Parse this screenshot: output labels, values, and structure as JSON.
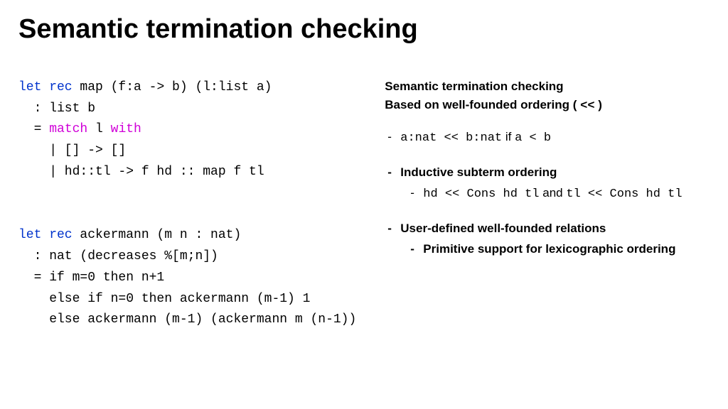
{
  "title": "Semantic termination checking",
  "code": {
    "map": {
      "l1a": "let rec",
      "l1b": " map (f:a -> b) (l:list a)",
      "l2": "  : list b",
      "l3a": "  = ",
      "l3b": "match",
      "l3c": " l ",
      "l3d": "with",
      "l4": "    | [] -> []",
      "l5": "    | hd::tl -> f hd :: map f tl"
    },
    "ack": {
      "l1a": "let rec",
      "l1b": " ackermann (m n : nat)",
      "l2": "  : nat (decreases %[m;n])",
      "l3": "  = if m=0 then n+1",
      "l4": "    else if n=0 then ackermann (m-1) 1",
      "l5": "    else ackermann (m-1) (ackermann m (n-1))"
    }
  },
  "notes": {
    "h1": "Semantic termination checking",
    "h2a": "Based on well-founded ordering ( ",
    "h2b": "<<",
    "h2c": " )",
    "b1a": "a:nat << b:nat",
    "b1b": " if ",
    "b1c": "a < b",
    "b2": "Inductive subterm ordering",
    "b2s_a": "hd << Cons hd tl",
    "b2s_b": " and ",
    "b2s_c": "tl << Cons hd tl",
    "b3": "User-defined well-founded relations",
    "b3s": "Primitive support for lexicographic ordering"
  }
}
